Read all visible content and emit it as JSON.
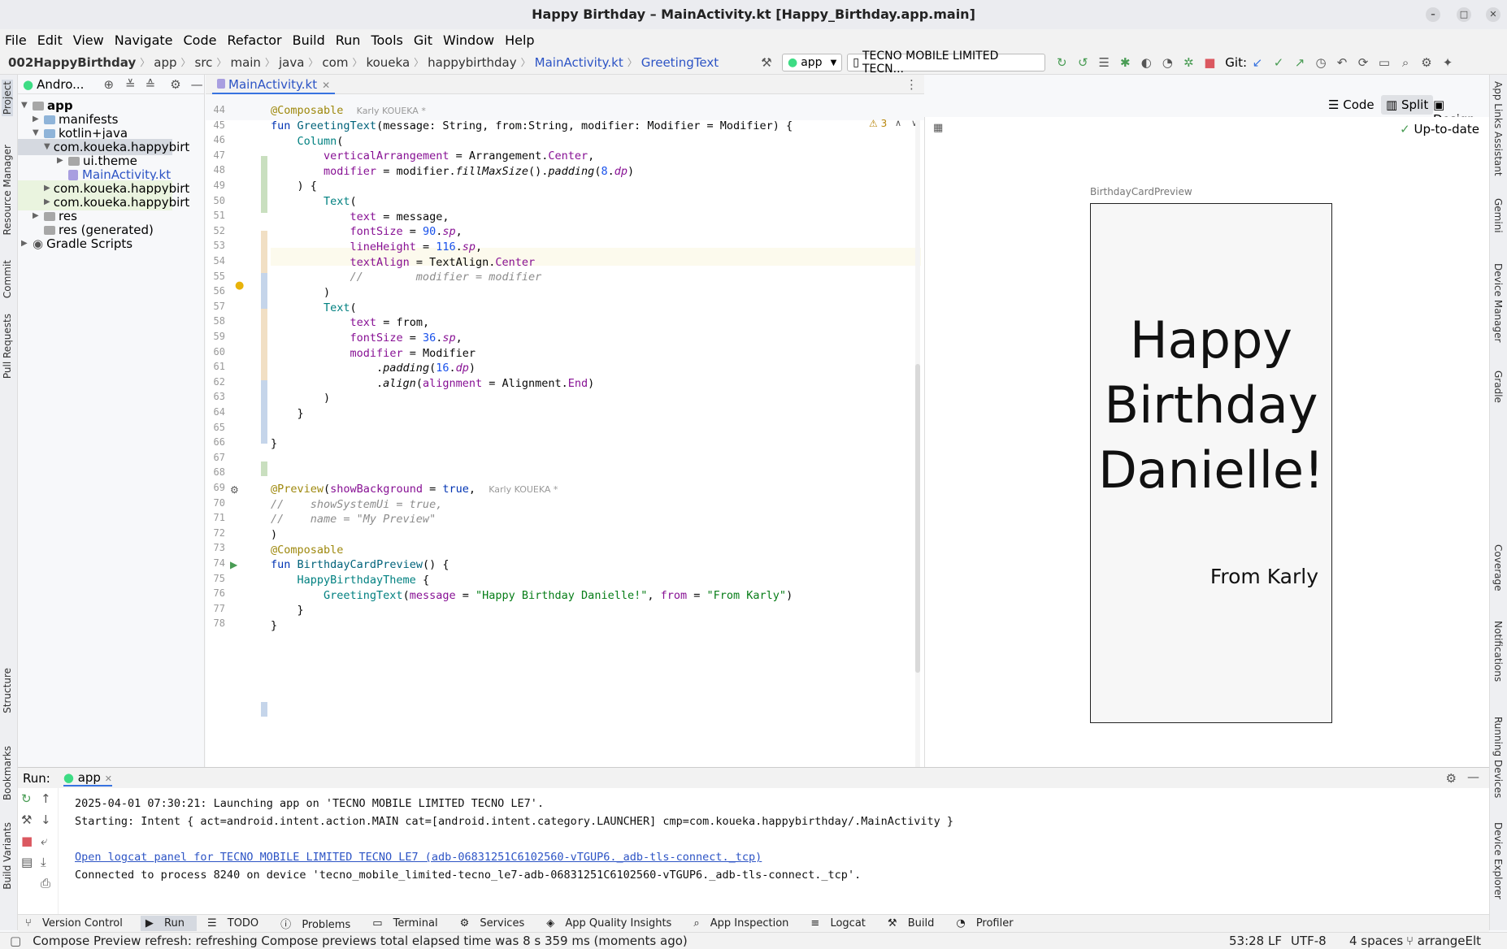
{
  "window": {
    "title": "Happy Birthday – MainActivity.kt [Happy_Birthday.app.main]"
  },
  "menu": [
    "File",
    "Edit",
    "View",
    "Navigate",
    "Code",
    "Refactor",
    "Build",
    "Run",
    "Tools",
    "Git",
    "Window",
    "Help"
  ],
  "breadcrumbs": [
    "002HappyBirthday",
    "app",
    "src",
    "main",
    "java",
    "com",
    "koueka",
    "happybirthday",
    "MainActivity.kt",
    "GreetingText"
  ],
  "toolbar": {
    "config": "app",
    "device": "TECNO MOBILE LIMITED TECN...",
    "git_label": "Git:"
  },
  "project_panel": {
    "title": "Andro...",
    "tree": [
      {
        "label": "app"
      },
      {
        "label": "manifests"
      },
      {
        "label": "kotlin+java"
      },
      {
        "label": "com.koueka.happybirt"
      },
      {
        "label": "ui.theme"
      },
      {
        "label": "MainActivity.kt"
      },
      {
        "label": "com.koueka.happybirt"
      },
      {
        "label": "com.koueka.happybirt"
      },
      {
        "label": "res"
      },
      {
        "label": "res (generated)"
      },
      {
        "label": "Gradle Scripts"
      }
    ]
  },
  "left_strip": [
    "Project",
    "Resource Manager",
    "Commit",
    "Pull Requests",
    "Structure",
    "Bookmarks",
    "Build Variants"
  ],
  "right_strip": [
    "App Links Assistant",
    "Gemini",
    "Device Manager",
    "Gradle",
    "Coverage",
    "Notifications",
    "Running Devices",
    "Device Explorer"
  ],
  "editor": {
    "tab": "MainActivity.kt",
    "warnings": "3",
    "author_hint": "Karly KOUEKA *",
    "line_numbers": [
      "44",
      "45",
      "46",
      "47",
      "48",
      "49",
      "50",
      "51",
      "52",
      "53",
      "54",
      "55",
      "56",
      "57",
      "58",
      "59",
      "60",
      "61",
      "62",
      "63",
      "64",
      "65",
      "66",
      "67",
      "68",
      "69",
      "70",
      "71",
      "72",
      "73",
      "74",
      "75",
      "76",
      "77",
      "78"
    ]
  },
  "view_modes": {
    "code": "Code",
    "split": "Split",
    "design": "Design",
    "status": "Up-to-date"
  },
  "preview": {
    "name": "BirthdayCardPreview",
    "greeting_line1": "Happy",
    "greeting_line2": "Birthday",
    "greeting_line3": "Danielle!",
    "from": "From Karly"
  },
  "run": {
    "label": "Run:",
    "tab": "app",
    "lines": [
      "2025-04-01 07:30:21: Launching app on 'TECNO MOBILE LIMITED TECNO LE7'.",
      "Starting: Intent { act=android.intent.action.MAIN cat=[android.intent.category.LAUNCHER] cmp=com.koueka.happybirthday/.MainActivity }",
      "",
      "Open logcat panel for TECNO MOBILE LIMITED TECNO LE7 (adb-06831251C6102560-vTGUP6._adb-tls-connect._tcp)",
      "Connected to process 8240 on device 'tecno_mobile_limited-tecno_le7-adb-06831251C6102560-vTGUP6._adb-tls-connect._tcp'."
    ]
  },
  "tool_windows": [
    "Version Control",
    "Run",
    "TODO",
    "Problems",
    "Terminal",
    "Services",
    "App Quality Insights",
    "App Inspection",
    "Logcat",
    "Build",
    "Profiler"
  ],
  "status": {
    "message": "Compose Preview refresh: refreshing Compose previews total elapsed time was 8 s 359 ms (moments ago)",
    "position": "53:28",
    "line_sep": "LF",
    "encoding": "UTF-8",
    "indent": "4 spaces",
    "branch": "arrangeElt"
  }
}
